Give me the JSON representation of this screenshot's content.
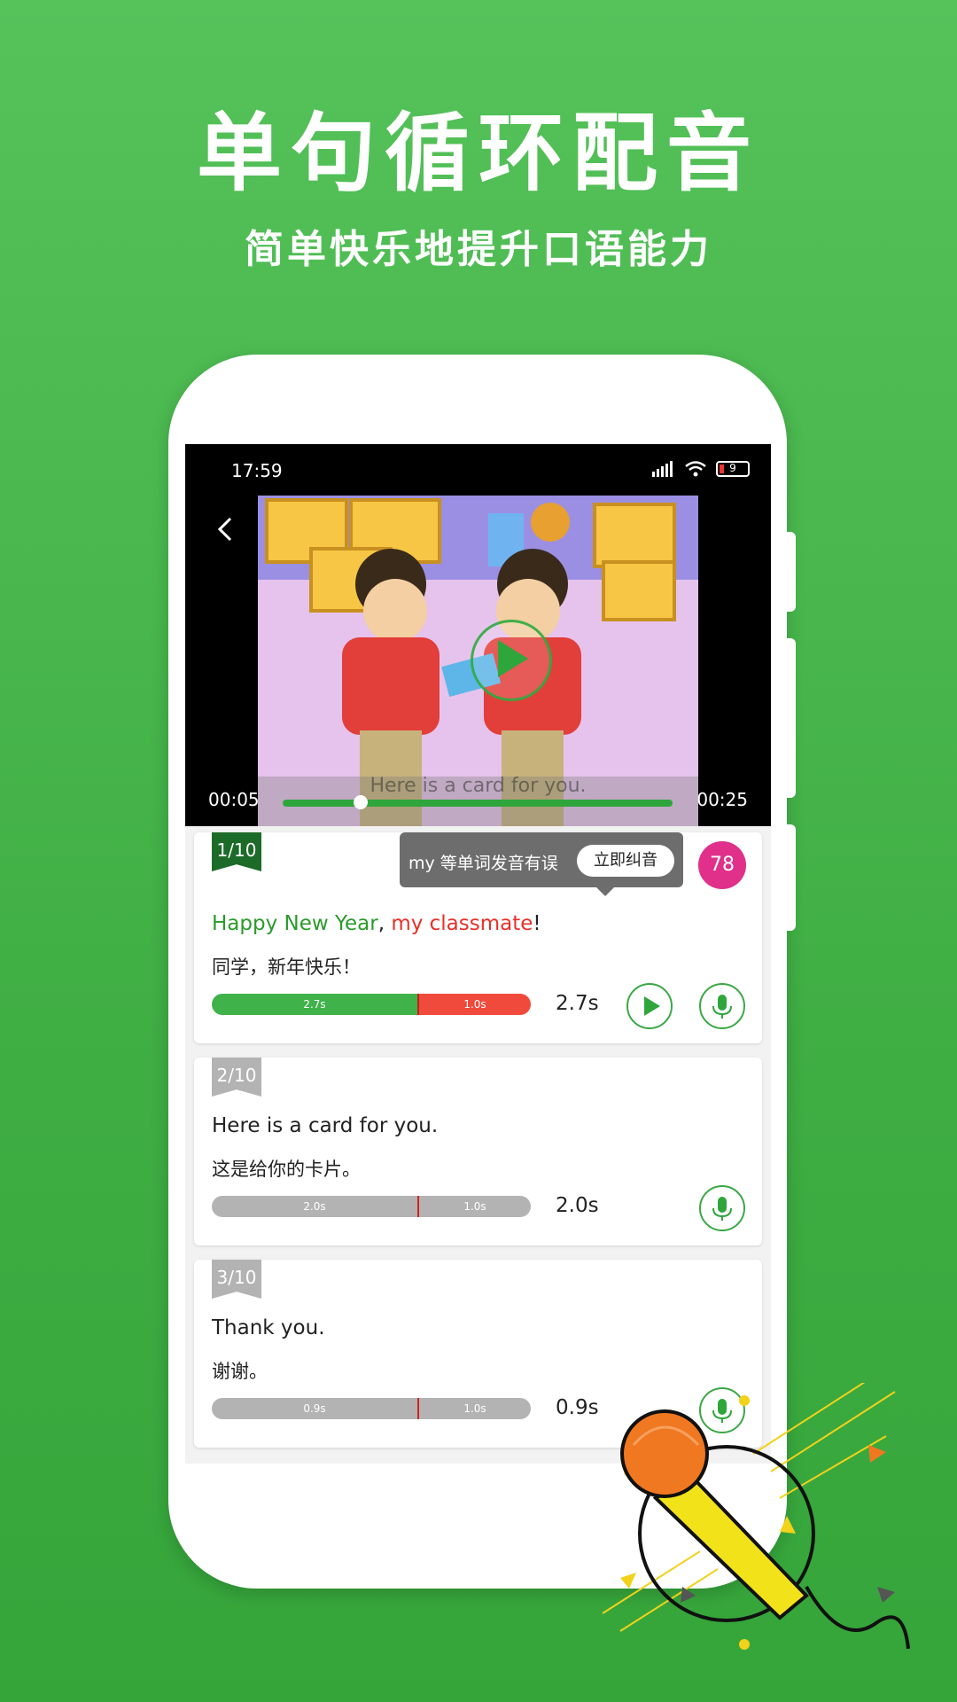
{
  "promo": {
    "headline": "单句循环配音",
    "subline": "简单快乐地提升口语能力"
  },
  "status_bar": {
    "time": "17:59",
    "battery": "9"
  },
  "video": {
    "current_time": "00:05",
    "total_time": "00:25",
    "progress": 0.2,
    "subtitle": "Here is a card for you."
  },
  "sentences": [
    {
      "index_label": "1/10",
      "en_parts": [
        {
          "text": "Happy New Year",
          "status": "correct"
        },
        {
          "text": ", ",
          "status": "neutral"
        },
        {
          "text": "my classmate",
          "status": "wrong"
        },
        {
          "text": "!",
          "status": "neutral"
        }
      ],
      "cn": "同学，新年快乐！",
      "bar_user_label": "2.7s",
      "bar_orig_label": "1.0s",
      "duration": "2.7s",
      "tip_text": "my 等单词发音有误",
      "tip_button": "立即纠音",
      "score": "78",
      "has_play": true
    },
    {
      "index_label": "2/10",
      "en": "Here is a card for you.",
      "cn": "这是给你的卡片。",
      "bar_user_label": "2.0s",
      "bar_orig_label": "1.0s",
      "duration": "2.0s",
      "has_play": false
    },
    {
      "index_label": "3/10",
      "en": "Thank you.",
      "cn": "谢谢。",
      "bar_user_label": "0.9s",
      "bar_orig_label": "1.0s",
      "duration": "0.9s",
      "has_play": false
    }
  ],
  "colors": {
    "background": "#4cb950",
    "active_green": "#2ea63c",
    "error_red": "#f04a3c",
    "inactive_gray": "#b3b3b3",
    "tag_dark_green": "#1c6b28",
    "score_pink": "#e0308a"
  },
  "icons": [
    "back-chevron-icon",
    "play-icon",
    "mic-icon",
    "signal-icon",
    "wifi-icon",
    "battery-icon",
    "microphone-illustration"
  ]
}
